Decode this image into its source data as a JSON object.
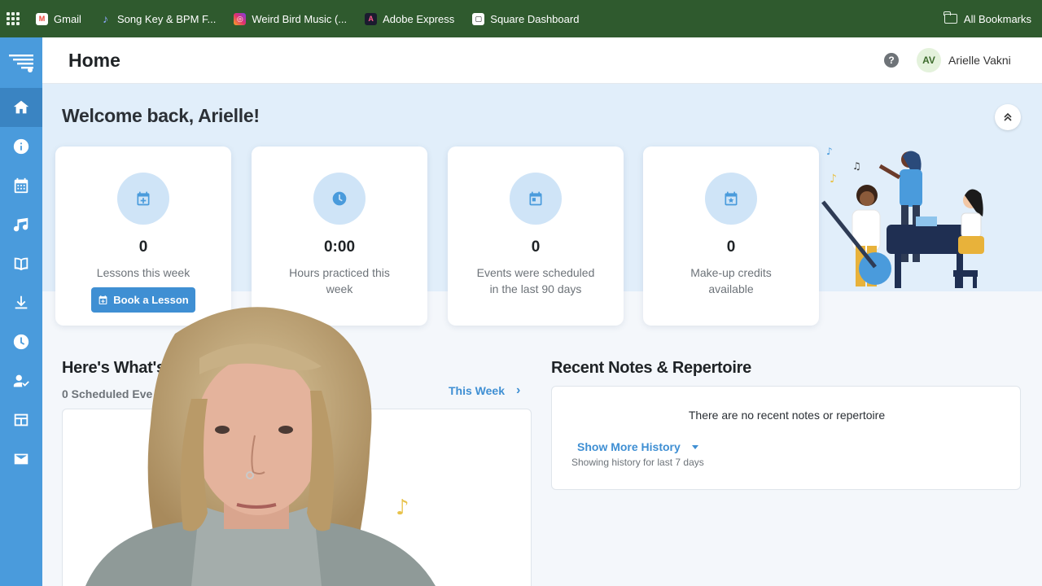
{
  "bookmarks": [
    {
      "label": "Gmail",
      "icon": "gmail-icon",
      "color": "#ea4335",
      "glyph": "M"
    },
    {
      "label": "Song Key & BPM F...",
      "icon": "song-key-icon",
      "color": "#5b7cf0",
      "glyph": "♪"
    },
    {
      "label": "Weird Bird Music (...",
      "icon": "instagram-icon",
      "color": "#e1306c",
      "glyph": "◎"
    },
    {
      "label": "Adobe Express",
      "icon": "adobe-express-icon",
      "color": "#1b1b2f",
      "glyph": "A"
    },
    {
      "label": "Square Dashboard",
      "icon": "square-icon",
      "color": "#111111",
      "glyph": "▢"
    }
  ],
  "all_bookmarks": "All Bookmarks",
  "header": {
    "title": "Home",
    "help": "?",
    "avatar_initials": "AV",
    "user_name": "Arielle Vakni"
  },
  "sidebar": {
    "items": [
      "home-icon",
      "info-icon",
      "calendar-icon",
      "music-icon",
      "book-icon",
      "download-icon",
      "clock-icon",
      "user-check-icon",
      "table-icon",
      "mail-icon"
    ],
    "active": "home-icon"
  },
  "welcome": "Welcome back, Arielle!",
  "cards": [
    {
      "value": "0",
      "label": "Lessons this week",
      "icon": "calendar-plus-icon",
      "button": "Book a Lesson"
    },
    {
      "value": "0:00",
      "label": "Hours practiced this week",
      "icon": "clock-icon"
    },
    {
      "value": "0",
      "label": "Events were scheduled in the last 90 days",
      "icon": "calendar-icon"
    },
    {
      "value": "0",
      "label": "Make-up credits available",
      "icon": "calendar-star-icon"
    }
  ],
  "schedule": {
    "title": "Here's What's",
    "count_label": "0 Scheduled Eve",
    "range_label": "This Week"
  },
  "notes": {
    "title": "Recent Notes & Repertoire",
    "empty": "There are no recent notes or repertoire",
    "show_more": "Show More History",
    "sub": "Showing history for last 7 days"
  },
  "colors": {
    "sidebar": "#4a9bdc",
    "bookmark_bar": "#2f5a2e",
    "accent": "#3f8fd3",
    "banner": "#e1eefa"
  }
}
